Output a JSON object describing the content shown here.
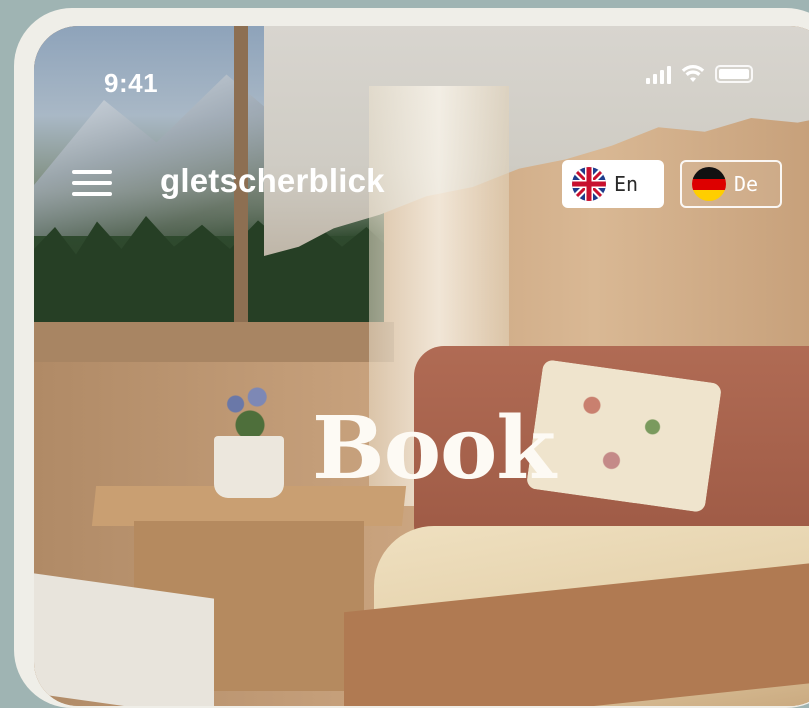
{
  "status_bar": {
    "time": "9:41"
  },
  "nav": {
    "brand": "gletscherblick",
    "languages": [
      {
        "code": "En",
        "flag": "uk-flag-icon",
        "active": true
      },
      {
        "code": "De",
        "flag": "germany-flag-icon",
        "active": false
      }
    ]
  },
  "hero": {
    "title": "Book"
  },
  "colors": {
    "background": "#9fb4b3",
    "frame": "#efeee8",
    "text_light": "#ffffff"
  }
}
